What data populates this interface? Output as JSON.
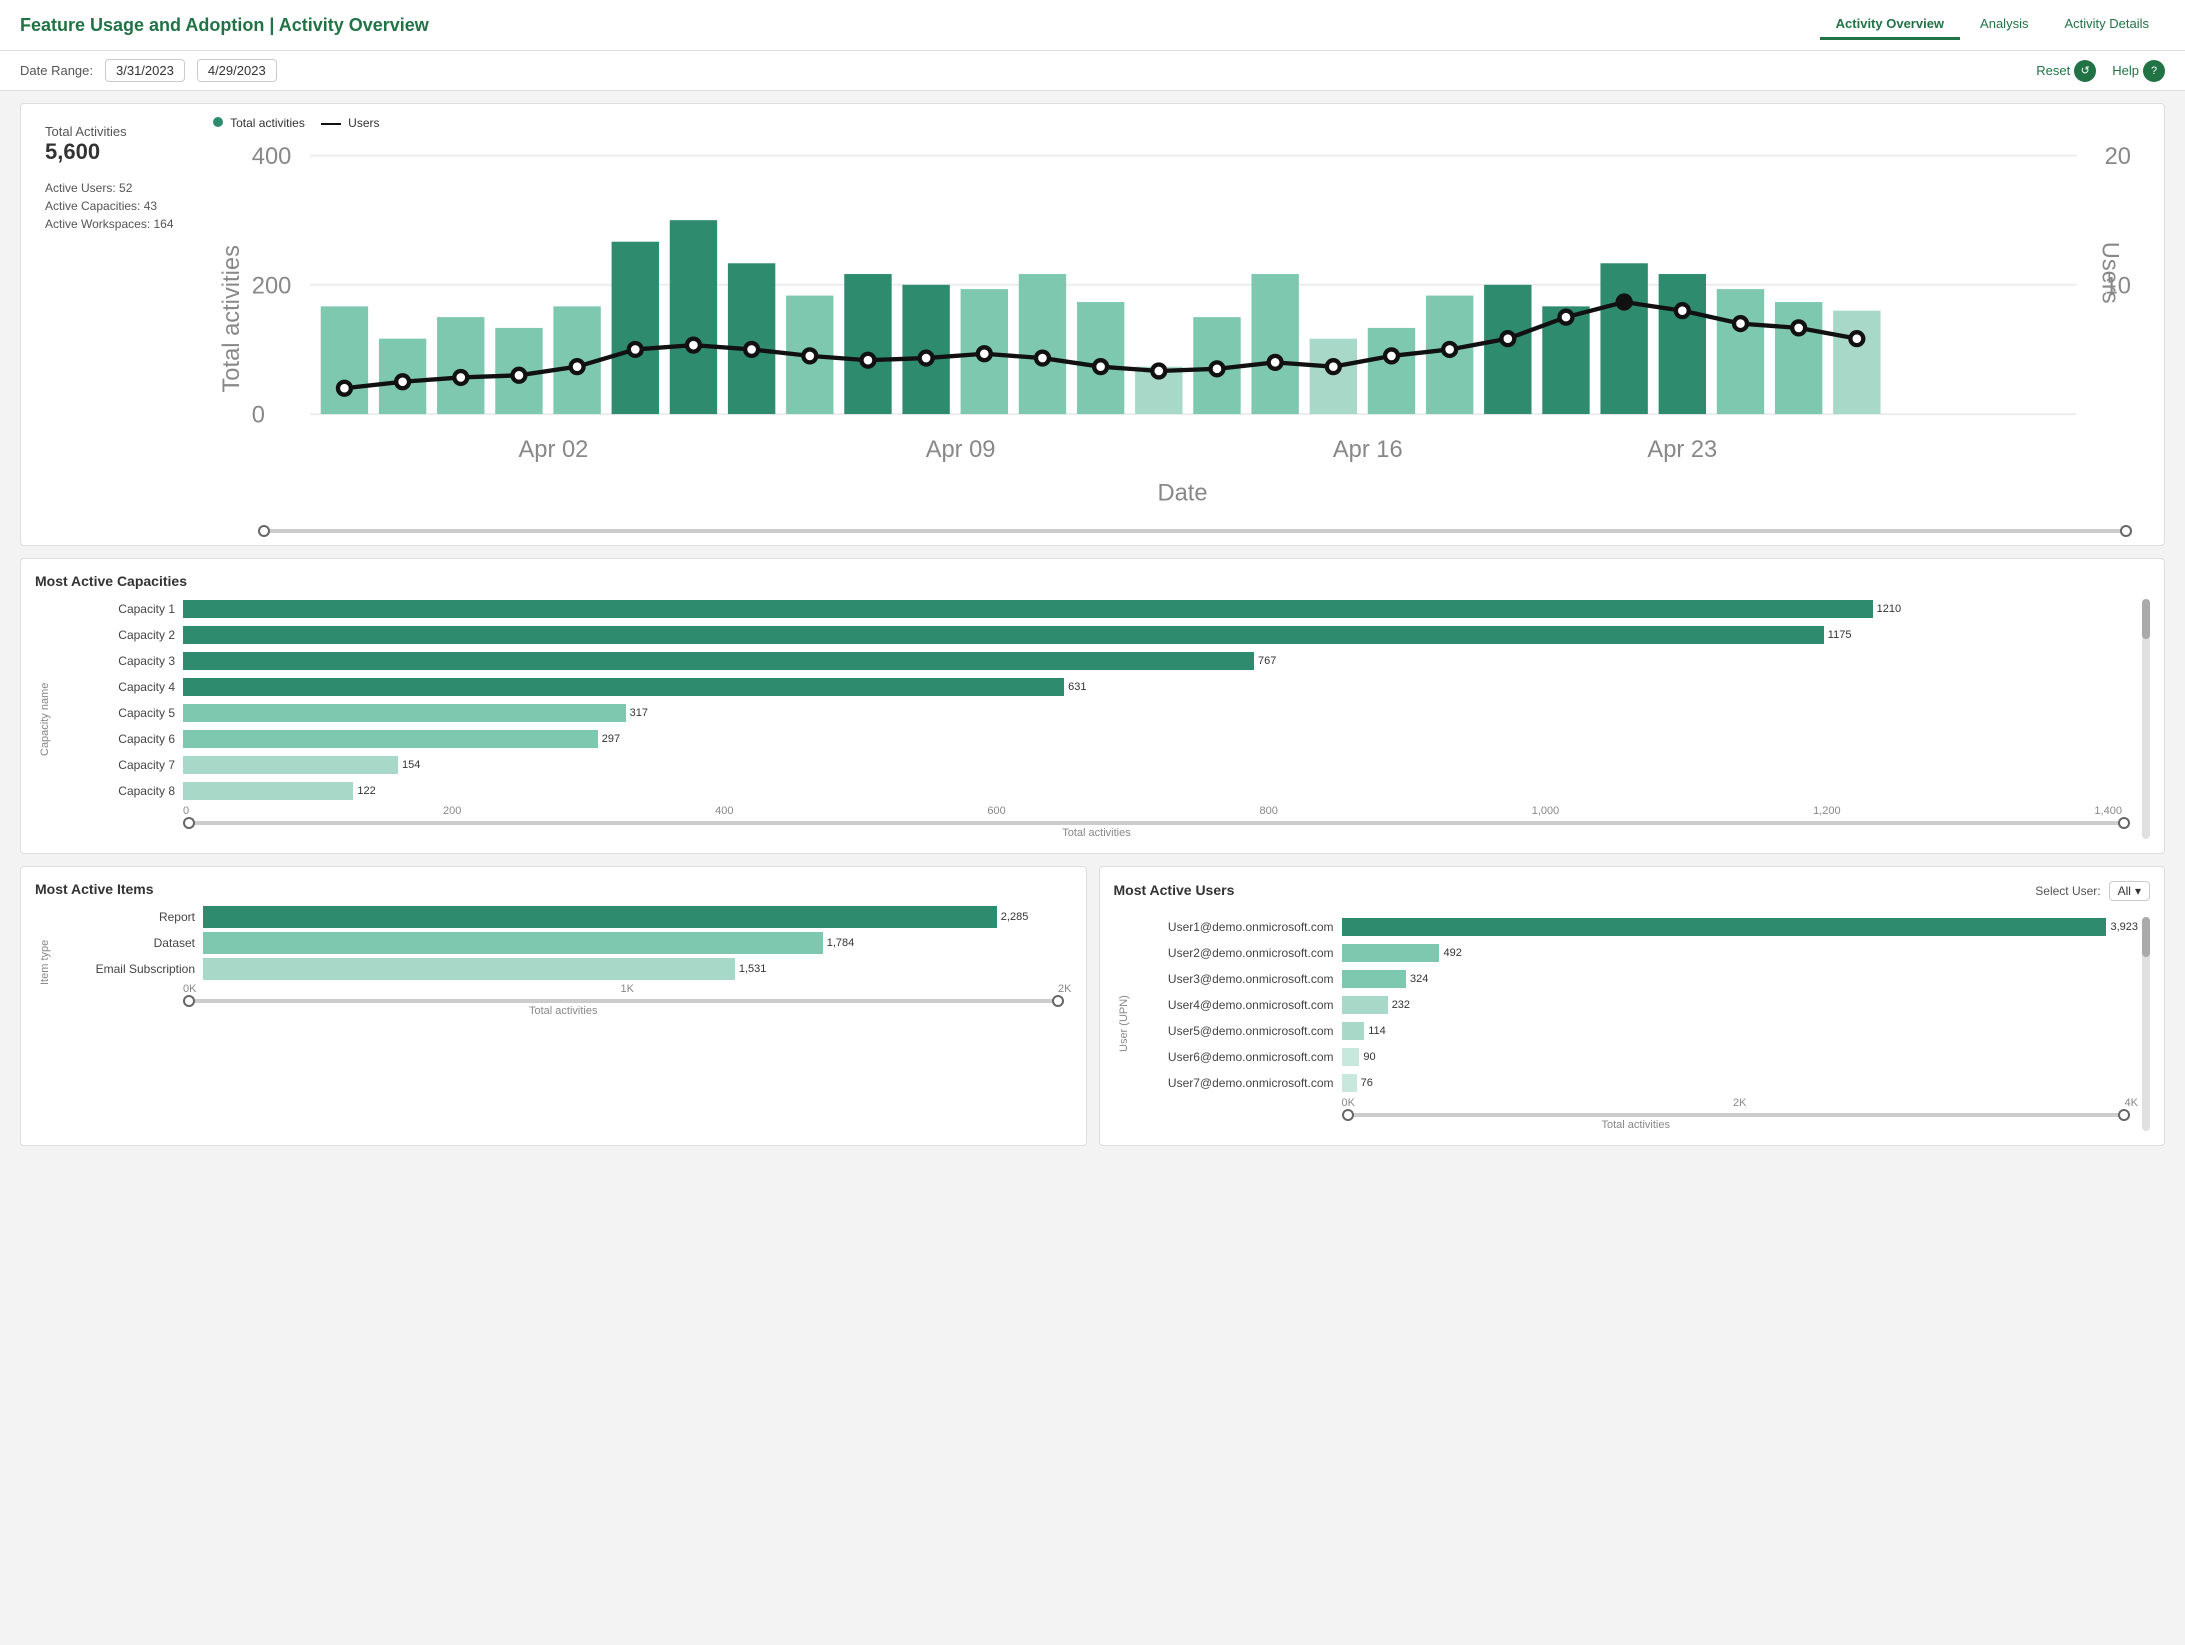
{
  "header": {
    "title": "Feature Usage and Adoption | Activity Overview",
    "nav": {
      "tabs": [
        {
          "label": "Activity Overview",
          "active": true
        },
        {
          "label": "Analysis",
          "active": false
        },
        {
          "label": "Activity Details",
          "active": false
        }
      ]
    },
    "toolbar": {
      "dateLabel": "Date Range:",
      "startDate": "3/31/2023",
      "endDate": "4/29/2023",
      "resetLabel": "Reset",
      "helpLabel": "Help"
    }
  },
  "summary": {
    "totalActivitiesLabel": "Total Activities",
    "totalActivitiesValue": "5,600",
    "activeUsersLabel": "Active Users: 52",
    "activeCapacitiesLabel": "Active Capacities: 43",
    "activeWorkspacesLabel": "Active Workspaces: 164",
    "chartLegend": {
      "totalActivitiesLabel": "Total activities",
      "usersLabel": "Users"
    },
    "chartXLabels": [
      "Apr 02",
      "Apr 09",
      "Apr 16",
      "Apr 23"
    ],
    "chartYLeft": [
      "400",
      "200",
      "0"
    ],
    "chartYRight": [
      "20",
      "10"
    ]
  },
  "capacities": {
    "sectionTitle": "Most Active Capacities",
    "yAxisLabel": "Capacity name",
    "xAxisLabel": "Total activities",
    "xAxisTicks": [
      "0",
      "200",
      "400",
      "600",
      "800",
      "1,000",
      "1,200",
      "1,400"
    ],
    "maxValue": 1400,
    "items": [
      {
        "label": "Capacity 1",
        "value": 1210,
        "color": "#2e8b6e"
      },
      {
        "label": "Capacity 2",
        "value": 1175,
        "color": "#2e8b6e"
      },
      {
        "label": "Capacity 3",
        "value": 767,
        "color": "#2e8b6e"
      },
      {
        "label": "Capacity 4",
        "value": 631,
        "color": "#2e8b6e"
      },
      {
        "label": "Capacity 5",
        "value": 317,
        "color": "#7ec8b0"
      },
      {
        "label": "Capacity 6",
        "value": 297,
        "color": "#7ec8b0"
      },
      {
        "label": "Capacity 7",
        "value": 154,
        "color": "#a8d8c8"
      },
      {
        "label": "Capacity 8",
        "value": 122,
        "color": "#a8d8c8"
      }
    ]
  },
  "items": {
    "sectionTitle": "Most Active Items",
    "yAxisLabel": "Item type",
    "xAxisLabel": "Total activities",
    "xAxisTicks": [
      "0K",
      "1K",
      "2K"
    ],
    "maxValue": 2500,
    "data": [
      {
        "label": "Report",
        "value": 2285,
        "color": "#2e8b6e"
      },
      {
        "label": "Dataset",
        "value": 1784,
        "color": "#7ec8b0"
      },
      {
        "label": "Email Subscription",
        "value": 1531,
        "color": "#a8d8c8"
      }
    ]
  },
  "users": {
    "sectionTitle": "Most Active Users",
    "selectLabel": "Select User:",
    "selectValue": "All",
    "yAxisLabel": "User (UPN)",
    "xAxisLabel": "Total activities",
    "xAxisTicks": [
      "0K",
      "2K",
      "4K"
    ],
    "maxValue": 4000,
    "data": [
      {
        "label": "User1@demo.onmicrosoft.com",
        "value": 3923,
        "color": "#2e8b6e"
      },
      {
        "label": "User2@demo.onmicrosoft.com",
        "value": 492,
        "color": "#7ec8b0"
      },
      {
        "label": "User3@demo.onmicrosoft.com",
        "value": 324,
        "color": "#7ec8b0"
      },
      {
        "label": "User4@demo.onmicrosoft.com",
        "value": 232,
        "color": "#a8d8c8"
      },
      {
        "label": "User5@demo.onmicrosoft.com",
        "value": 114,
        "color": "#a8d8c8"
      },
      {
        "label": "User6@demo.onmicrosoft.com",
        "value": 90,
        "color": "#c8e8de"
      },
      {
        "label": "User7@demo.onmicrosoft.com",
        "value": 76,
        "color": "#c8e8de"
      }
    ]
  },
  "colors": {
    "brand": "#217346",
    "barDark": "#2e8b6e",
    "barMid": "#7ec8b0",
    "barLight": "#a8d8c8",
    "barLighter": "#c8e8de"
  }
}
